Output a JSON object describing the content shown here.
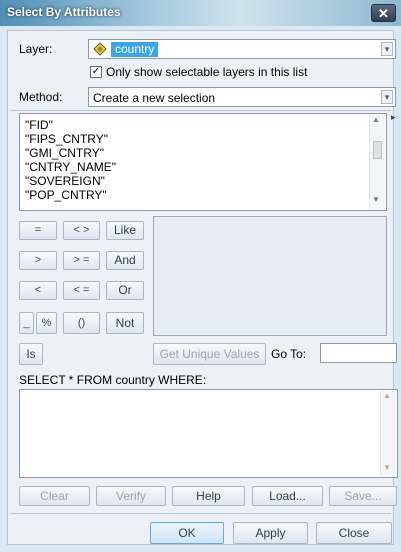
{
  "window": {
    "title": "Select By Attributes",
    "close_glyph": "✕"
  },
  "layer": {
    "label": "Layer:",
    "value": "country",
    "only_selectable_label": "Only show selectable layers in this list",
    "only_selectable_checked": true
  },
  "method": {
    "label": "Method:",
    "value": "Create a new selection"
  },
  "fields": [
    "\"FID\"",
    "\"FIPS_CNTRY\"",
    "\"GMI_CNTRY\"",
    "\"CNTRY_NAME\"",
    "\"SOVEREIGN\"",
    "\"POP_CNTRY\""
  ],
  "operators": {
    "eq": "=",
    "ne": "< >",
    "like": "Like",
    "gt": ">",
    "ge": "> =",
    "and": "And",
    "lt": "<",
    "le": "< =",
    "or": "Or",
    "underscore": "_",
    "percent": "%",
    "parens": "()",
    "not": "Not",
    "is": "Is"
  },
  "unique_values_button": "Get Unique Values",
  "goto_label": "Go To:",
  "goto_value": "",
  "sql_prefix": "SELECT * FROM country WHERE:",
  "where_clause": "",
  "buttons": {
    "clear": "Clear",
    "verify": "Verify",
    "help": "Help",
    "load": "Load...",
    "save": "Save...",
    "ok": "OK",
    "apply": "Apply",
    "close": "Close"
  },
  "icons": {
    "close": "close-icon",
    "layer": "layer-diamond-icon",
    "dropdown": "chevron-down-icon",
    "scroll_up": "scroll-up-icon",
    "scroll_down": "scroll-down-icon",
    "checkbox": "checkmark-icon"
  }
}
